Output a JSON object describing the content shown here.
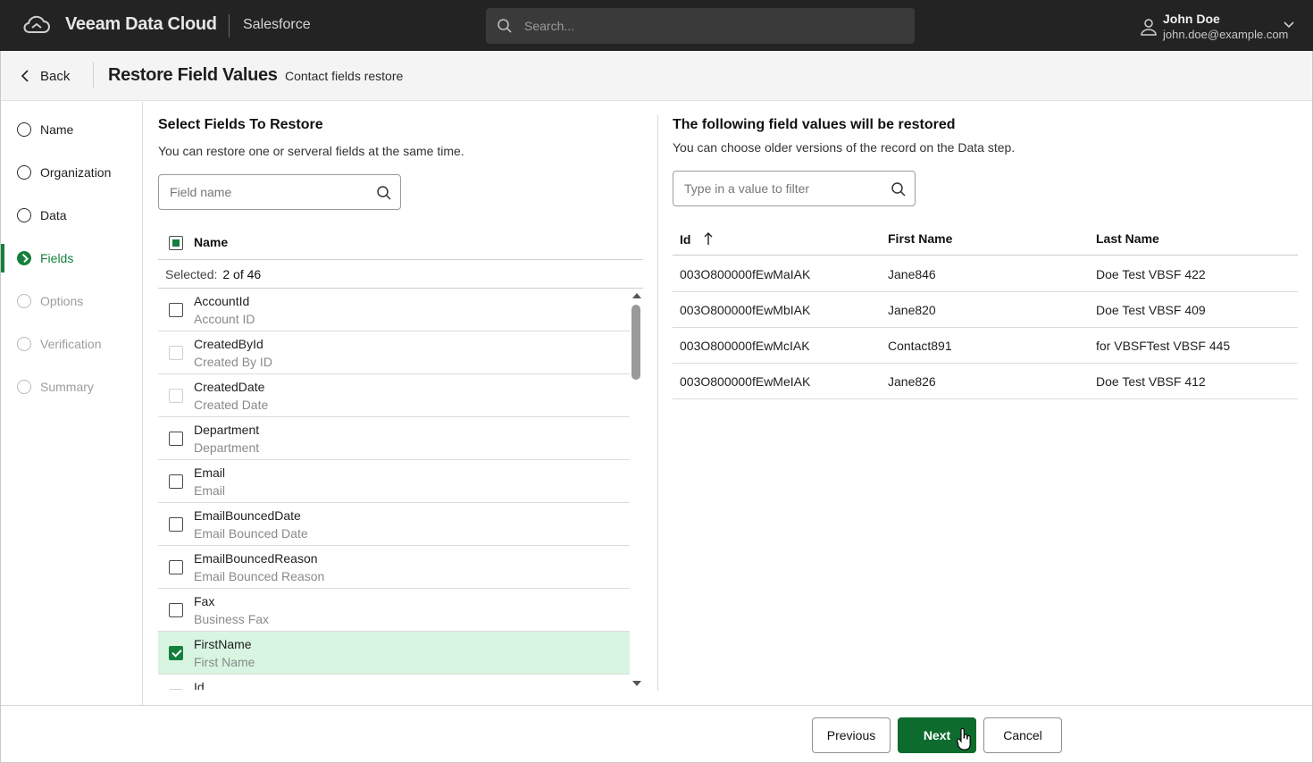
{
  "topbar": {
    "brand": "Veeam Data Cloud",
    "product": "Salesforce",
    "search_placeholder": "Search...",
    "user_name": "John Doe",
    "user_email": "john.doe@example.com"
  },
  "header": {
    "back_label": "Back",
    "title": "Restore Field Values",
    "subtitle": "Contact fields restore"
  },
  "steps": [
    {
      "label": "Name",
      "state": "normal"
    },
    {
      "label": "Organization",
      "state": "normal"
    },
    {
      "label": "Data",
      "state": "normal"
    },
    {
      "label": "Fields",
      "state": "active"
    },
    {
      "label": "Options",
      "state": "disabled"
    },
    {
      "label": "Verification",
      "state": "disabled"
    },
    {
      "label": "Summary",
      "state": "disabled"
    }
  ],
  "left": {
    "title": "Select Fields To Restore",
    "description": "You can restore one or serveral fields at the same time.",
    "search_placeholder": "Field name",
    "column_name": "Name",
    "selected_label": "Selected:",
    "selected_count": "2 of 46",
    "rows": [
      {
        "api": "AccountId",
        "label": "Account ID",
        "state": "unchecked"
      },
      {
        "api": "CreatedById",
        "label": "Created By ID",
        "state": "disabled"
      },
      {
        "api": "CreatedDate",
        "label": "Created Date",
        "state": "disabled"
      },
      {
        "api": "Department",
        "label": "Department",
        "state": "unchecked"
      },
      {
        "api": "Email",
        "label": "Email",
        "state": "unchecked"
      },
      {
        "api": "EmailBouncedDate",
        "label": "Email Bounced Date",
        "state": "unchecked"
      },
      {
        "api": "EmailBouncedReason",
        "label": "Email Bounced Reason",
        "state": "unchecked"
      },
      {
        "api": "Fax",
        "label": "Business Fax",
        "state": "unchecked"
      },
      {
        "api": "FirstName",
        "label": "First Name",
        "state": "checked"
      },
      {
        "api": "Id",
        "label": "",
        "state": "disabled"
      }
    ]
  },
  "right": {
    "title": "The following field values will be restored",
    "description": "You can choose older versions of the record on the Data step.",
    "filter_placeholder": "Type in a value to filter",
    "columns": [
      "Id",
      "First Name",
      "Last Name"
    ],
    "rows": [
      [
        "003O800000fEwMaIAK",
        "Jane846",
        "Doe Test VBSF 422"
      ],
      [
        "003O800000fEwMbIAK",
        "Jane820",
        "Doe Test VBSF 409"
      ],
      [
        "003O800000fEwMcIAK",
        "Contact891",
        "for VBSFTest VBSF 445"
      ],
      [
        "003O800000fEwMeIAK",
        "Jane826",
        "Doe Test VBSF 412"
      ]
    ]
  },
  "footer": {
    "previous": "Previous",
    "next": "Next",
    "cancel": "Cancel"
  },
  "colors": {
    "accent": "#15803d",
    "primary_button": "#0d6b2d",
    "selected_row": "#d8f5e1",
    "topbar": "#232323"
  }
}
